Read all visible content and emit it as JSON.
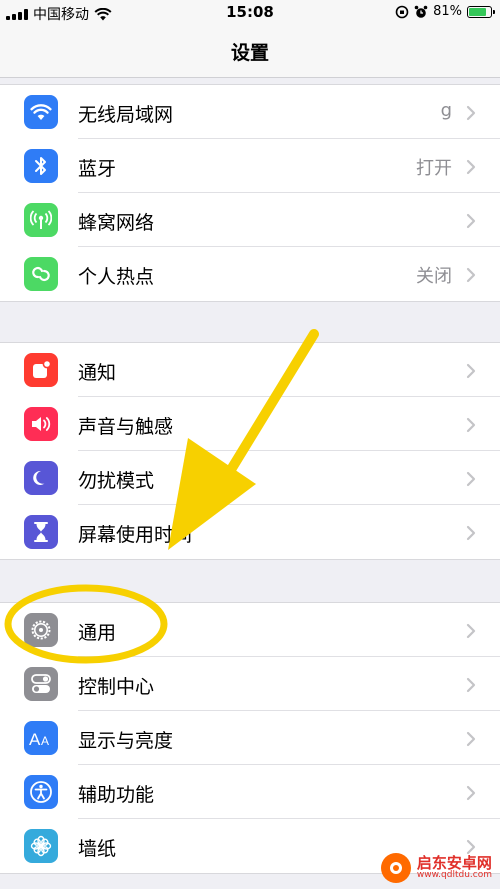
{
  "status_bar": {
    "carrier": "中国移动",
    "time": "15:08",
    "battery": "81%",
    "battery_level": 0.81
  },
  "nav": {
    "title": "设置"
  },
  "groups": [
    [
      {
        "label": "无线局域网",
        "value": "g",
        "icon": "wifi-icon",
        "color": "#2f7cf6"
      },
      {
        "label": "蓝牙",
        "value": "打开",
        "icon": "bluetooth-icon",
        "color": "#2f7cf6"
      },
      {
        "label": "蜂窝网络",
        "value": "",
        "icon": "cellular-icon",
        "color": "#4cd964"
      },
      {
        "label": "个人热点",
        "value": "关闭",
        "icon": "hotspot-icon",
        "color": "#4cd964"
      }
    ],
    [
      {
        "label": "通知",
        "value": "",
        "icon": "notification-icon",
        "color": "#ff3b30"
      },
      {
        "label": "声音与触感",
        "value": "",
        "icon": "sound-icon",
        "color": "#ff2d55"
      },
      {
        "label": "勿扰模式",
        "value": "",
        "icon": "moon-icon",
        "color": "#5856d6"
      },
      {
        "label": "屏幕使用时间",
        "value": "",
        "icon": "hourglass-icon",
        "color": "#5856d6"
      }
    ],
    [
      {
        "label": "通用",
        "value": "",
        "icon": "gear-icon",
        "color": "#8e8e93"
      },
      {
        "label": "控制中心",
        "value": "",
        "icon": "toggle-icon",
        "color": "#8e8e93"
      },
      {
        "label": "显示与亮度",
        "value": "",
        "icon": "text-size-icon",
        "color": "#2f7cf6"
      },
      {
        "label": "辅助功能",
        "value": "",
        "icon": "accessibility-icon",
        "color": "#2f7cf6"
      },
      {
        "label": "墙纸",
        "value": "",
        "icon": "flower-icon",
        "color": "#35aadc"
      }
    ]
  ],
  "annotation": {
    "color": "#f7d000"
  },
  "watermark": {
    "name": "启东安卓网",
    "url": "www.qdltdu.com"
  }
}
